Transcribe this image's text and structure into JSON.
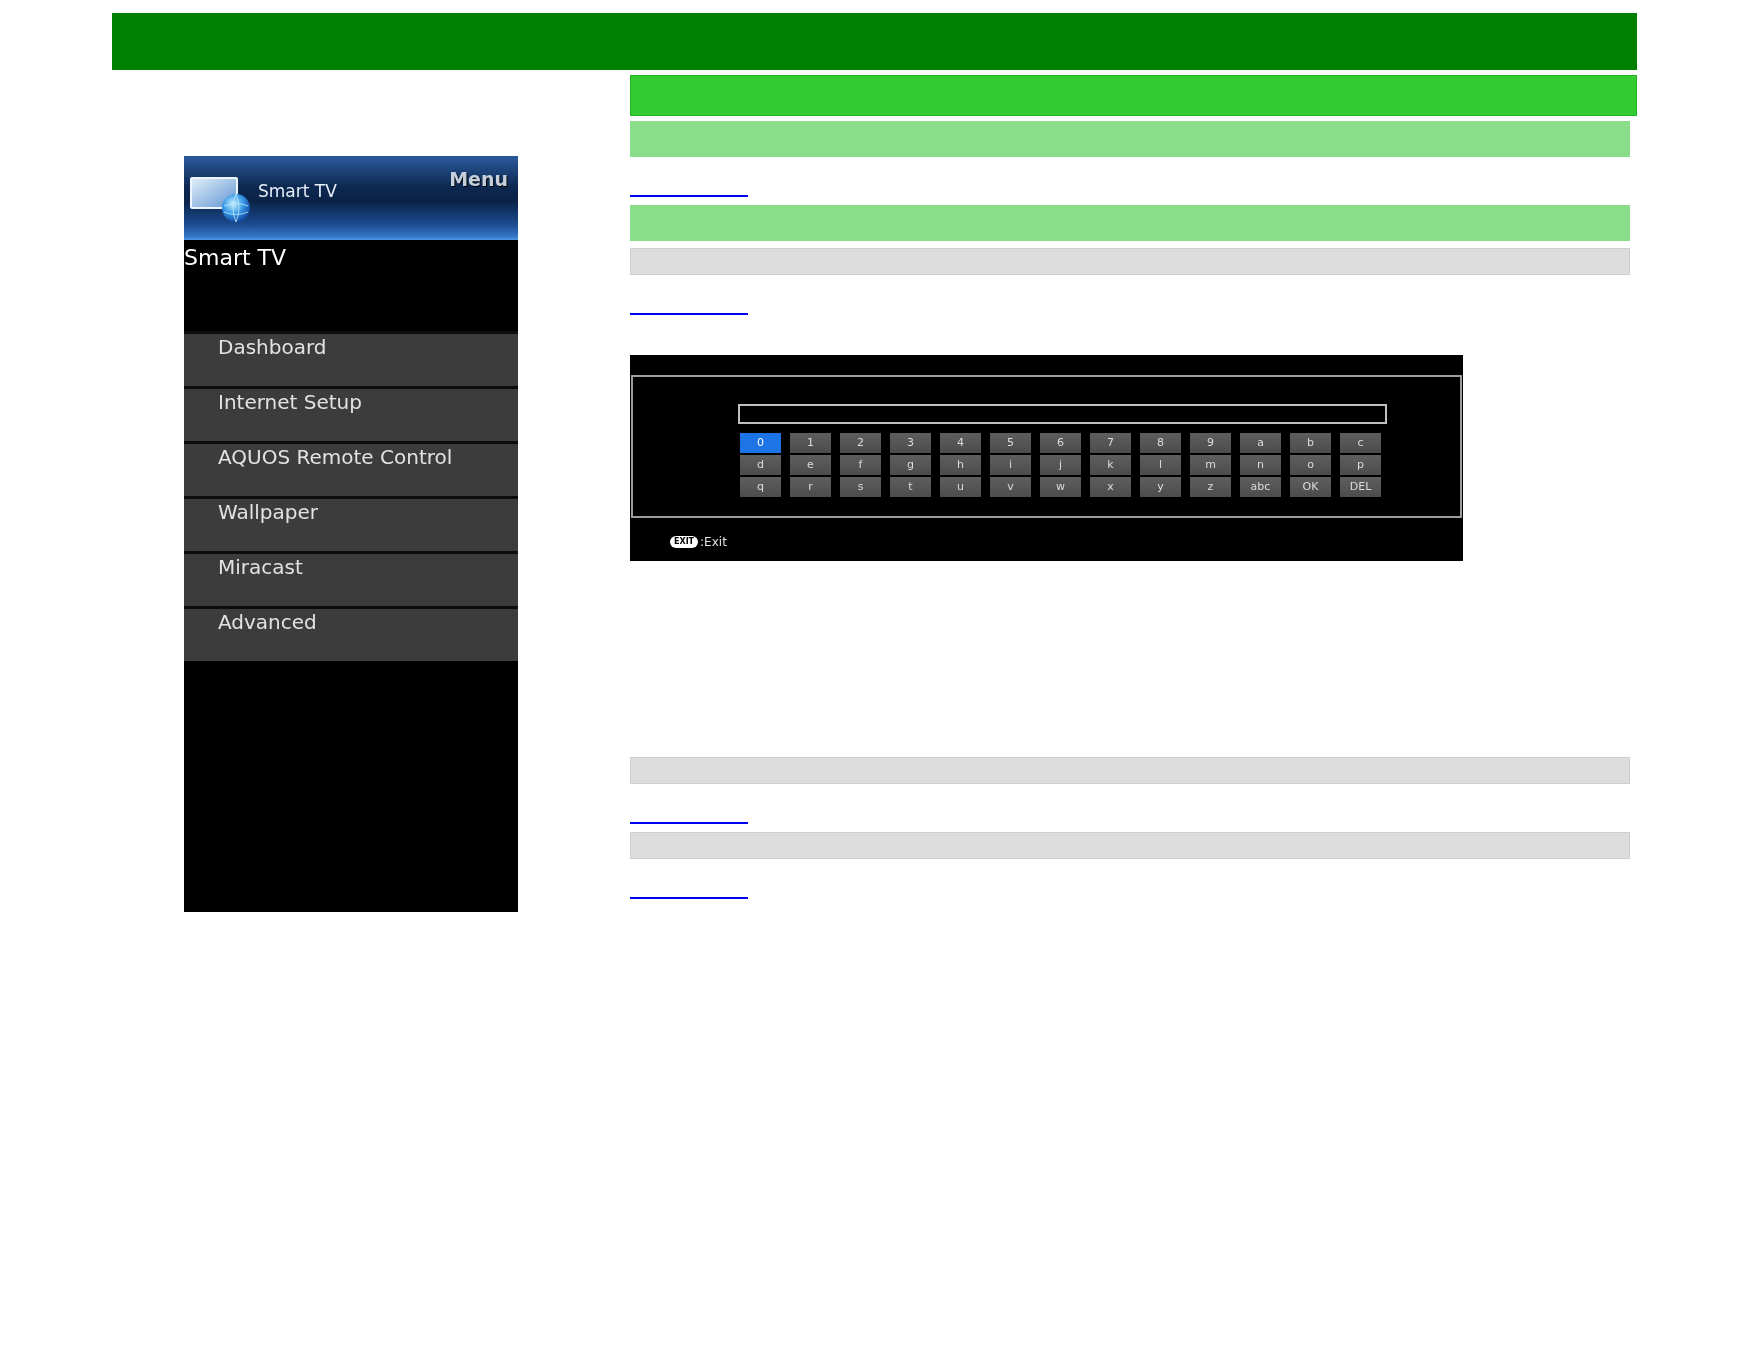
{
  "menu_panel": {
    "header_title": "Smart TV",
    "header_label": "Menu",
    "title": "Smart TV",
    "items": [
      {
        "label": "Dashboard"
      },
      {
        "label": "Internet Setup"
      },
      {
        "label": "AQUOS Remote Control"
      },
      {
        "label": "Wallpaper"
      },
      {
        "label": "Miracast"
      },
      {
        "label": "Advanced"
      }
    ]
  },
  "content": {
    "blocks": [
      {
        "kind": "heading_band"
      },
      {
        "kind": "subheading_band"
      },
      {
        "kind": "link"
      },
      {
        "kind": "subheading_band"
      },
      {
        "kind": "note_band"
      },
      {
        "kind": "link"
      },
      {
        "kind": "keyboard_screen",
        "keys": [
          {
            "label": "0",
            "selected": true
          },
          {
            "label": "1",
            "selected": false
          },
          {
            "label": "2",
            "selected": false
          },
          {
            "label": "3",
            "selected": false
          },
          {
            "label": "4",
            "selected": false
          },
          {
            "label": "5",
            "selected": false
          },
          {
            "label": "6",
            "selected": false
          },
          {
            "label": "7",
            "selected": false
          },
          {
            "label": "8",
            "selected": false
          },
          {
            "label": "9",
            "selected": false
          },
          {
            "label": "a",
            "selected": false
          },
          {
            "label": "b",
            "selected": false
          },
          {
            "label": "c",
            "selected": false
          },
          {
            "label": "d",
            "selected": false
          },
          {
            "label": "e",
            "selected": false
          },
          {
            "label": "f",
            "selected": false
          },
          {
            "label": "g",
            "selected": false
          },
          {
            "label": "h",
            "selected": false
          },
          {
            "label": "i",
            "selected": false
          },
          {
            "label": "j",
            "selected": false
          },
          {
            "label": "k",
            "selected": false
          },
          {
            "label": "l",
            "selected": false
          },
          {
            "label": "m",
            "selected": false
          },
          {
            "label": "n",
            "selected": false
          },
          {
            "label": "o",
            "selected": false
          },
          {
            "label": "p",
            "selected": false
          },
          {
            "label": "q",
            "selected": false
          },
          {
            "label": "r",
            "selected": false
          },
          {
            "label": "s",
            "selected": false
          },
          {
            "label": "t",
            "selected": false
          },
          {
            "label": "u",
            "selected": false
          },
          {
            "label": "v",
            "selected": false
          },
          {
            "label": "w",
            "selected": false
          },
          {
            "label": "x",
            "selected": false
          },
          {
            "label": "y",
            "selected": false
          },
          {
            "label": "z",
            "selected": false
          },
          {
            "label": "abc",
            "selected": false
          },
          {
            "label": "OK",
            "selected": false
          },
          {
            "label": "DEL",
            "selected": false
          }
        ],
        "exit_key": "EXIT",
        "exit_hint": ":Exit"
      },
      {
        "kind": "note_band"
      },
      {
        "kind": "link"
      },
      {
        "kind": "note_band"
      },
      {
        "kind": "link"
      }
    ]
  }
}
